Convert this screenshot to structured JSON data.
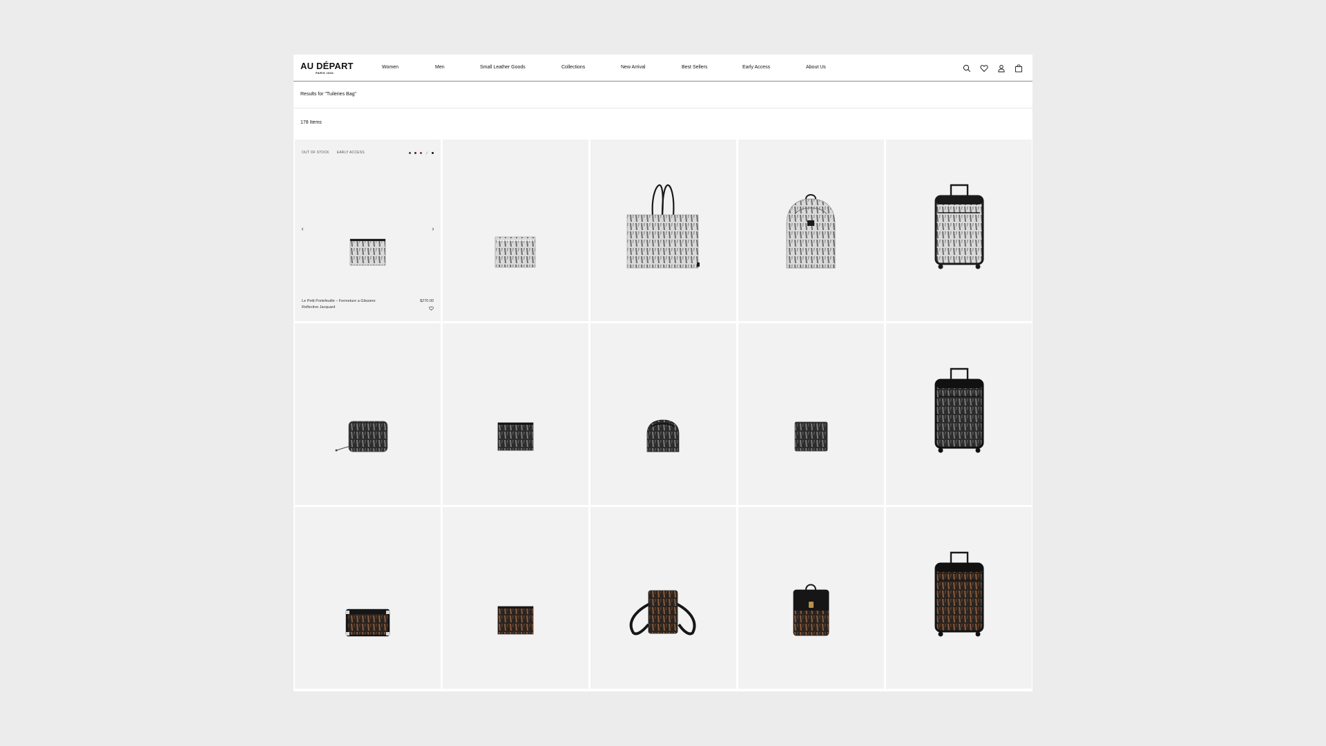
{
  "brand": {
    "name": "AU DÉPART",
    "tagline": "PARIS 1834"
  },
  "nav": {
    "items": [
      {
        "label": "Women"
      },
      {
        "label": "Men"
      },
      {
        "label": "Small Leather Goods"
      },
      {
        "label": "Collections"
      },
      {
        "label": "New Arrival"
      },
      {
        "label": "Best Sellers"
      },
      {
        "label": "Early Access"
      },
      {
        "label": "About Us"
      }
    ],
    "icons": [
      "search-icon",
      "heart-icon",
      "account-icon",
      "bag-icon"
    ]
  },
  "search": {
    "results_text": "Results for \"Tuileries Bag\""
  },
  "listing": {
    "count_text": "178 Items",
    "featured": {
      "badges": [
        "OUT OF STOCK",
        "EARLY ACCESS"
      ],
      "swatch_colors": [
        "#444444",
        "#2b2b2b",
        "#8a2b2b",
        "#111111"
      ],
      "name": "Le Petit Portefeuille – Fermeture a Glissiere Reflective Jacquard",
      "price": "$270.00",
      "prev_arrow": "‹",
      "next_arrow": "›"
    },
    "products": [
      {
        "type": "pouch",
        "pattern": "grey"
      },
      {
        "type": "flat-pouch",
        "pattern": "grey"
      },
      {
        "type": "tote",
        "pattern": "grey"
      },
      {
        "type": "backpack",
        "pattern": "grey"
      },
      {
        "type": "suitcase",
        "pattern": "grey"
      },
      {
        "type": "zip-wallet",
        "pattern": "dark"
      },
      {
        "type": "card-holder",
        "pattern": "dark"
      },
      {
        "type": "bucket-bag",
        "pattern": "dark"
      },
      {
        "type": "bifold-wallet",
        "pattern": "dark"
      },
      {
        "type": "suitcase",
        "pattern": "dark"
      },
      {
        "type": "trunk-bag",
        "pattern": "brown"
      },
      {
        "type": "card-holder",
        "pattern": "brown"
      },
      {
        "type": "crossbody",
        "pattern": "brown"
      },
      {
        "type": "mini-backpack",
        "pattern": "brown"
      },
      {
        "type": "suitcase",
        "pattern": "brown"
      }
    ]
  },
  "colors": {
    "page_background": "#ececec",
    "card_background": "#f2f2f2",
    "pattern_grey_base": "#d9d9d9",
    "pattern_grey_mark": "#6d6d6d",
    "pattern_dark_base": "#2c2c2c",
    "pattern_dark_mark": "#7a7a7a",
    "pattern_brown_base": "#2a2420",
    "pattern_brown_mark": "#8a5a3a",
    "leather_black": "#161616"
  }
}
